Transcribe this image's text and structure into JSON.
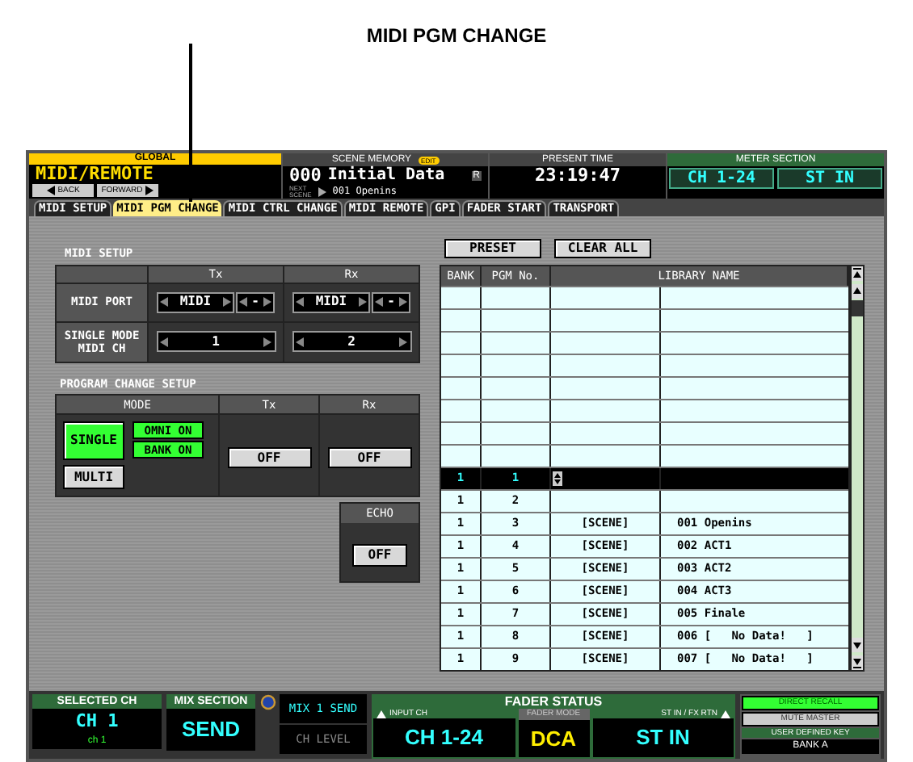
{
  "callout": {
    "label": "MIDI PGM CHANGE"
  },
  "header": {
    "global_label": "GLOBAL",
    "mode_title": "MIDI/REMOTE",
    "back": "BACK",
    "forward": "FORWARD",
    "scene_memory": {
      "title": "SCENE MEMORY",
      "edit_badge": "EDIT",
      "number": "000",
      "name": "Initial Data",
      "r_mark": "R",
      "next_label": [
        "NEXT",
        "SCENE"
      ],
      "next_scene": "001 Openins"
    },
    "present_time": {
      "title": "PRESENT TIME",
      "time": "23:19:47"
    },
    "meter_section": {
      "title": "METER SECTION",
      "buttons": [
        "CH 1-24",
        "ST IN"
      ]
    }
  },
  "tabs": [
    {
      "label": "MIDI SETUP",
      "selected": false
    },
    {
      "label": "MIDI PGM CHANGE",
      "selected": true
    },
    {
      "label": "MIDI CTRL CHANGE",
      "selected": false
    },
    {
      "label": "MIDI REMOTE",
      "selected": false
    },
    {
      "label": "GPI",
      "selected": false
    },
    {
      "label": "FADER START",
      "selected": false
    },
    {
      "label": "TRANSPORT",
      "selected": false
    }
  ],
  "midi_setup": {
    "title": "MIDI SETUP",
    "columns": [
      "Tx",
      "Rx"
    ],
    "rows": [
      {
        "kind": "port",
        "label": [
          "MIDI PORT"
        ],
        "tx": "MIDI",
        "tx_sub": "-",
        "rx": "MIDI",
        "rx_sub": "-"
      },
      {
        "kind": "channel",
        "label": [
          "SINGLE MODE",
          "MIDI CH"
        ],
        "tx": "1",
        "rx": "2"
      }
    ]
  },
  "program_change": {
    "title": "PROGRAM CHANGE SETUP",
    "columns": [
      "MODE",
      "Tx",
      "Rx"
    ],
    "modes": [
      {
        "label": "SINGLE",
        "selected": true
      },
      {
        "label": "MULTI",
        "selected": false
      }
    ],
    "options": [
      {
        "label": "OMNI ON",
        "on": true
      },
      {
        "label": "BANK ON",
        "on": true
      }
    ],
    "tx_button": "OFF",
    "rx_button": "OFF",
    "echo": {
      "title": "ECHO",
      "button": "OFF"
    }
  },
  "table": {
    "buttons": [
      "PRESET",
      "CLEAR ALL"
    ],
    "columns": [
      "BANK",
      "PGM No.",
      "LIBRARY NAME"
    ],
    "rows": [
      {
        "selected": false
      },
      {
        "selected": false
      },
      {
        "selected": false
      },
      {
        "selected": false
      },
      {
        "selected": false
      },
      {
        "selected": false
      },
      {
        "selected": false
      },
      {
        "selected": false
      },
      {
        "bank": "1",
        "pgm": "1",
        "selected": true
      },
      {
        "bank": "1",
        "pgm": "2",
        "selected": false
      },
      {
        "bank": "1",
        "pgm": "3",
        "type": "[SCENE]",
        "name": "001 Openins",
        "selected": false
      },
      {
        "bank": "1",
        "pgm": "4",
        "type": "[SCENE]",
        "name": "002 ACT1",
        "selected": false
      },
      {
        "bank": "1",
        "pgm": "5",
        "type": "[SCENE]",
        "name": "003 ACT2",
        "selected": false
      },
      {
        "bank": "1",
        "pgm": "6",
        "type": "[SCENE]",
        "name": "004 ACT3",
        "selected": false
      },
      {
        "bank": "1",
        "pgm": "7",
        "type": "[SCENE]",
        "name": "005 Finale",
        "selected": false
      },
      {
        "bank": "1",
        "pgm": "8",
        "type": "[SCENE]",
        "name": "006 [   No Data!   ]",
        "selected": false
      },
      {
        "bank": "1",
        "pgm": "9",
        "type": "[SCENE]",
        "name": "007 [   No Data!   ]",
        "selected": false
      }
    ]
  },
  "bottom": {
    "selected_ch": {
      "title": "SELECTED CH",
      "value": "CH  1",
      "sub": "ch 1"
    },
    "mix_section": {
      "title": "MIX SECTION",
      "value": "SEND"
    },
    "send_items": [
      {
        "label": "MIX 1 SEND",
        "selected": true
      },
      {
        "label": "CH LEVEL",
        "selected": false
      }
    ],
    "fader_status": {
      "title": "FADER STATUS",
      "input_label": "INPUT CH",
      "input_value": "CH 1-24",
      "mode_label": "FADER MODE",
      "mode_value": "DCA",
      "stin_label": "ST IN / FX RTN",
      "stin_value": "ST IN"
    },
    "keys": [
      {
        "label": "DIRECT RECALL",
        "on": true
      },
      {
        "label": "MUTE MASTER",
        "on": false
      }
    ],
    "user_key": {
      "title": "USER DEFINED KEY",
      "bank": "BANK A"
    }
  }
}
